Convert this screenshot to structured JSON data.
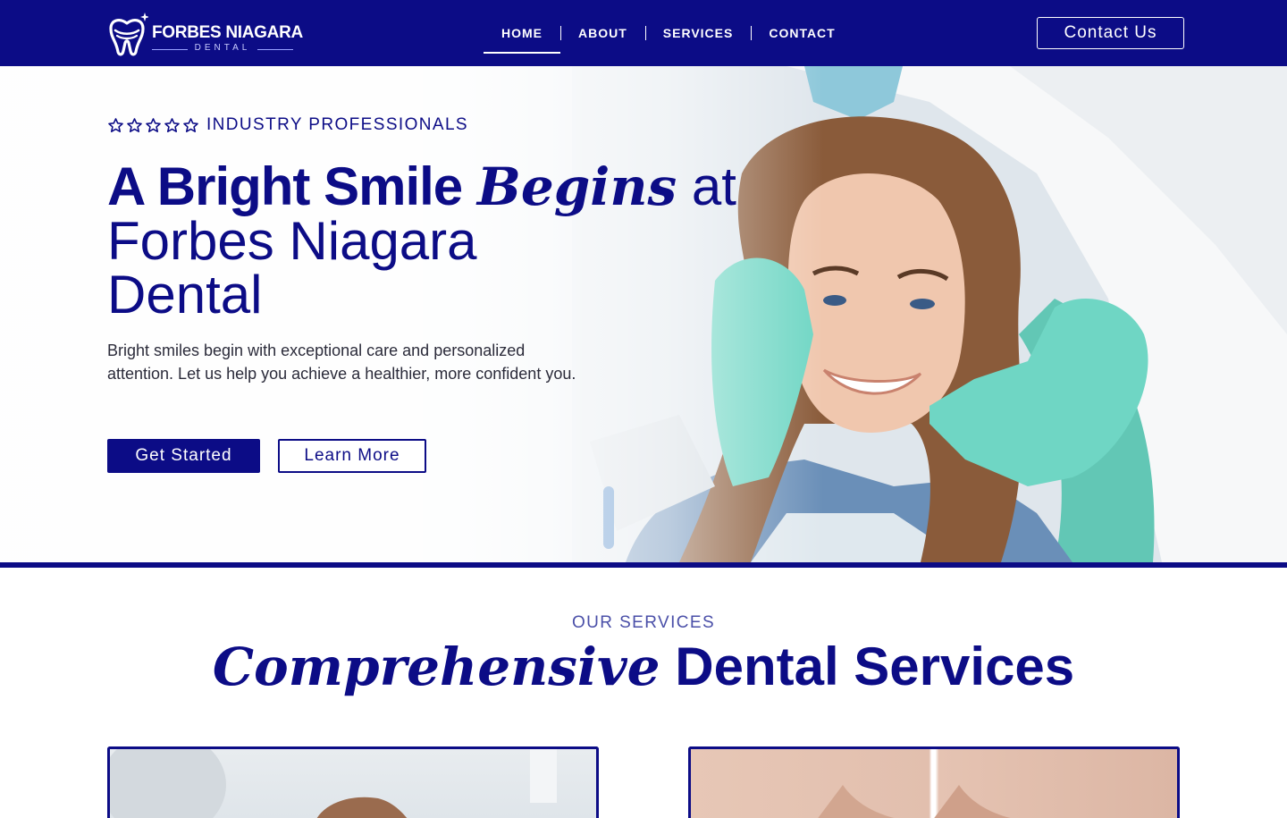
{
  "brand": {
    "name": "FORBES NIAGARA",
    "sub": "DENTAL",
    "logo_icon": "tooth-sparkle-icon"
  },
  "nav": {
    "items": [
      {
        "label": "HOME",
        "active": true
      },
      {
        "label": "ABOUT",
        "active": false
      },
      {
        "label": "SERVICES",
        "active": false
      },
      {
        "label": "CONTACT",
        "active": false
      }
    ],
    "cta": "Contact Us"
  },
  "hero": {
    "rating_icon": "star-outline-icon",
    "stars": 5,
    "eyebrow": "INDUSTRY PROFESSIONALS",
    "headline": {
      "bold": "A Bright Smile",
      "italic": "Begins",
      "light": "at",
      "line2": "Forbes Niagara",
      "line3": "Dental"
    },
    "description": "Bright smiles begin with exceptional care and personalized attention. Let us help you achieve a healthier, more confident you.",
    "primary_button": "Get Started",
    "secondary_button": "Learn More",
    "image": "smiling-patient-dental-checkup"
  },
  "services": {
    "eyebrow": "OUR SERVICES",
    "title_italic": "Comprehensive",
    "title_rest": "Dental Services",
    "cards": [
      {
        "image": "dentist-with-patient"
      },
      {
        "image": "teeth-before-after"
      }
    ]
  },
  "colors": {
    "brand_navy": "#0c0c86",
    "glove_teal": "#6fd6c4",
    "white": "#ffffff"
  }
}
